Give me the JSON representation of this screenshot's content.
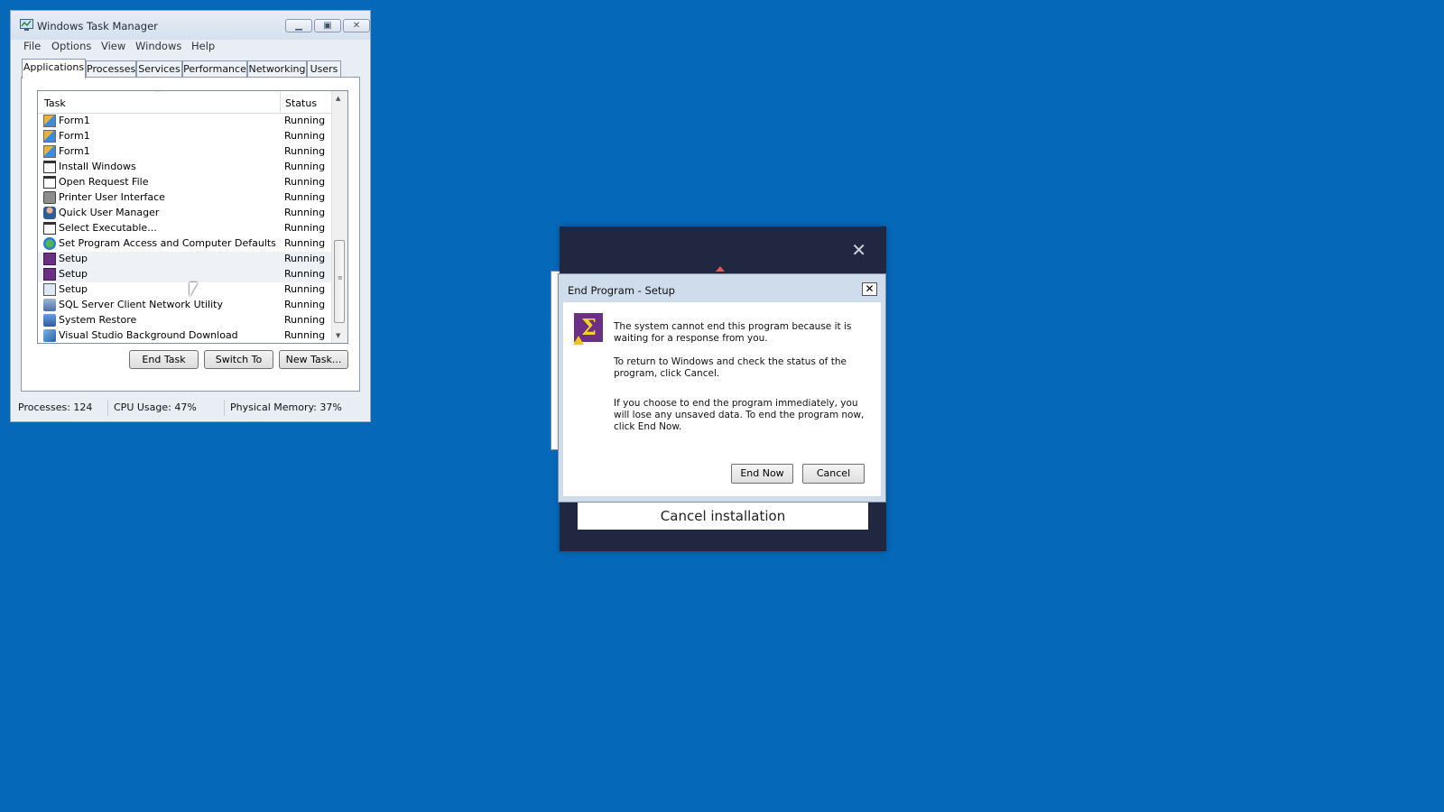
{
  "task_manager": {
    "title": "Windows Task Manager",
    "menu": [
      "File",
      "Options",
      "View",
      "Windows",
      "Help"
    ],
    "tabs": [
      "Applications",
      "Processes",
      "Services",
      "Performance",
      "Networking",
      "Users"
    ],
    "active_tab": "Applications",
    "columns": {
      "task": "Task",
      "status": "Status"
    },
    "rows": [
      {
        "task": "Form1",
        "status": "Running",
        "icon": "form-icon"
      },
      {
        "task": "Form1",
        "status": "Running",
        "icon": "form-icon"
      },
      {
        "task": "Form1",
        "status": "Running",
        "icon": "form-icon"
      },
      {
        "task": "Install Windows",
        "status": "Running",
        "icon": "window-icon"
      },
      {
        "task": "Open Request File",
        "status": "Running",
        "icon": "window-icon"
      },
      {
        "task": "Printer User Interface",
        "status": "Running",
        "icon": "printer-icon"
      },
      {
        "task": "Quick User Manager",
        "status": "Running",
        "icon": "user-icon"
      },
      {
        "task": "Select Executable...",
        "status": "Running",
        "icon": "window-icon"
      },
      {
        "task": "Set Program Access and Computer Defaults",
        "status": "Running",
        "icon": "globe-icon"
      },
      {
        "task": "Setup",
        "status": "Running",
        "icon": "setup-icon"
      },
      {
        "task": "Setup",
        "status": "Running",
        "icon": "setup-icon"
      },
      {
        "task": "Setup",
        "status": "Running",
        "icon": "installer-icon"
      },
      {
        "task": "SQL Server Client Network Utility",
        "status": "Running",
        "icon": "sql-icon"
      },
      {
        "task": "System Restore",
        "status": "Running",
        "icon": "restore-icon"
      },
      {
        "task": "Visual Studio Background Download",
        "status": "Running",
        "icon": "vs-icon"
      }
    ],
    "buttons": {
      "end_task": "End Task",
      "switch_to": "Switch To",
      "new_task": "New Task..."
    },
    "status_bar": {
      "processes": "Processes: 124",
      "cpu": "CPU Usage: 47%",
      "memory": "Physical Memory: 37%"
    }
  },
  "installer": {
    "close_glyph": "✕",
    "cancel_label": "Cancel installation"
  },
  "dialog": {
    "title": "End Program - Setup",
    "close_glyph": "✕",
    "text1": "The system cannot end this program because it is waiting for a response from you.",
    "text2": "To return to Windows and check the status of the program, click Cancel.",
    "text3": "If you choose to end the program immediately, you will lose any unsaved data. To end the program now, click End Now.",
    "end_now": "End Now",
    "cancel": "Cancel"
  },
  "colors": {
    "desktop": "#0568b9",
    "installer_bg": "#212641",
    "dialog_frame": "#cfdcec",
    "setup_icon": "#6b2f84"
  }
}
